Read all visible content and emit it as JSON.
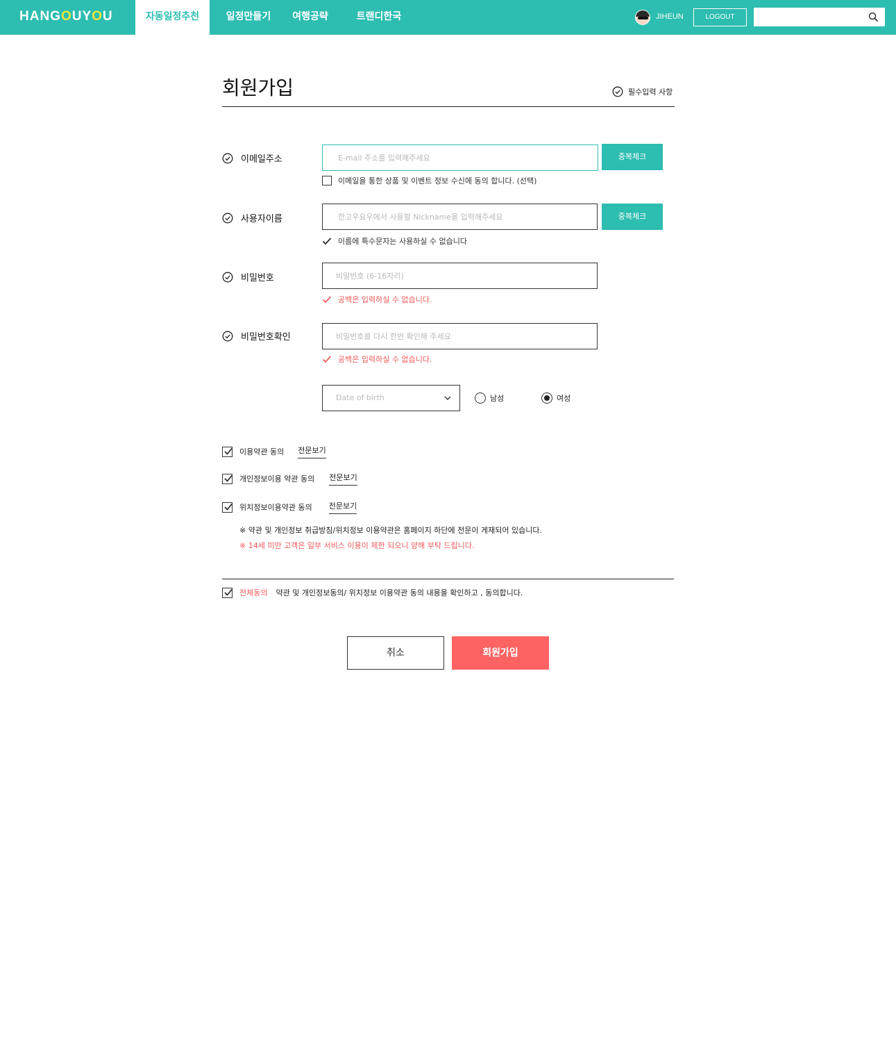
{
  "header": {
    "logo": {
      "part1": "HANG",
      "o1": "O",
      "part2": "UY",
      "o2": "O",
      "part3": "U"
    },
    "nav": [
      {
        "label": "자동일정추천",
        "active": true
      },
      {
        "label": "일정만들기",
        "active": false
      },
      {
        "label": "여행공략",
        "active": false
      },
      {
        "label": "트랜디한국",
        "active": false
      }
    ],
    "user": {
      "name": "JIHEUN"
    },
    "logout_label": "LOGOUT",
    "search": {
      "value": ""
    }
  },
  "form": {
    "title": "회원가입",
    "required_note": "필수입력 사항",
    "email": {
      "label": "이메일주소",
      "placeholder": "E-mail 주소를 입력해주세요",
      "check_label": "중복체크",
      "consent": "이메일을 통한 상품 및 이벤트 정보 수신에 동의 합니다. (선택)"
    },
    "username": {
      "label": "사용자이름",
      "placeholder": "한고우요우에서 사용할 Nickname을 입력해주세요",
      "check_label": "중복체크",
      "hint": "이름에 특수문자는 사용하실 수 없습니다"
    },
    "password": {
      "label": "비밀번호",
      "placeholder": "비밀번호 (6-16자리)",
      "error": "공백은 입력하실 수 없습니다."
    },
    "password_confirm": {
      "label": "비밀번호확인",
      "placeholder": "비밀번호를 다시 한번 확인해 주세요",
      "error": "공백은 입력하실 수 없습니다."
    },
    "dob": {
      "placeholder": "Date of birth"
    },
    "gender": {
      "male": "남성",
      "female": "여성",
      "selected": "female"
    }
  },
  "agreements": {
    "items": [
      {
        "label": "이용약관 동의",
        "link": "전문보기",
        "checked": true
      },
      {
        "label": "개인정보이용 약관 동의",
        "link": "전문보기",
        "checked": true
      },
      {
        "label": "위치정보이용약관 동의",
        "link": "전문보기",
        "checked": true
      }
    ],
    "notice": "※ 약관 및 개인정보 취급방침/위치정보 이용약관은 홈페이지 하단에 전문이 게재되어 있습니다.",
    "notice_red": "※ 14세 미만 고객은 일부 서비스 이용이 제한 되오니 양해 부탁 드립니다.",
    "all": {
      "label": "전체동의",
      "text": "약관 및 개인정보동의/ 위치정보 이용약관 동의 내용을 확인하고 , 동의합니다.",
      "checked": true
    }
  },
  "buttons": {
    "cancel": "취소",
    "submit": "회원가입"
  },
  "colors": {
    "accent": "#2dbdb1",
    "danger": "#f25a5a",
    "submit": "#fd6363"
  }
}
